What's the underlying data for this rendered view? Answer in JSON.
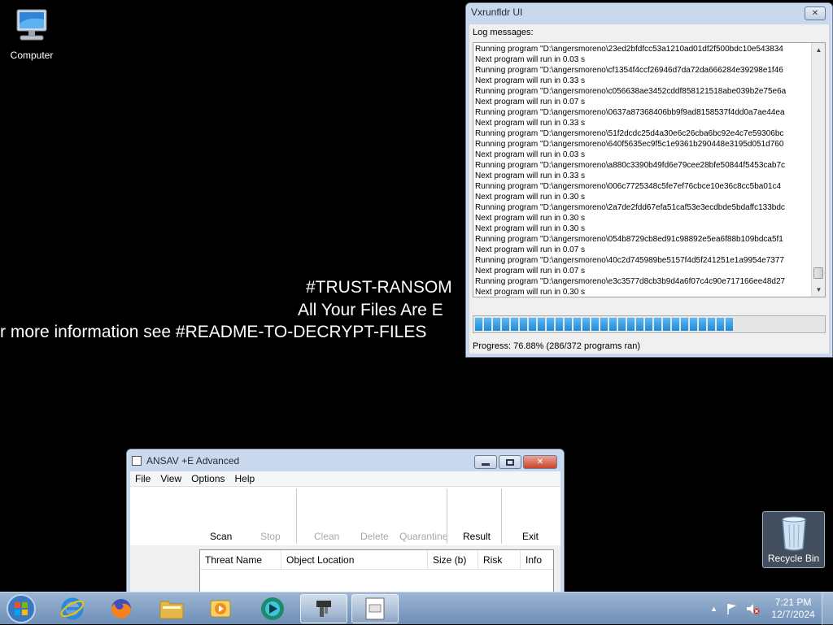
{
  "desktop": {
    "computer_label": "Computer",
    "recycle_label": "Recycle Bin"
  },
  "ransom": {
    "line1": "#TRUST-RANSOM",
    "line2": "All Your Files Are E",
    "line3": "r more information see #README-TO-DECRYPT-FILES"
  },
  "vxrunfldr": {
    "title": "Vxrunfldr UI",
    "close_symbol": "✕",
    "log_label": "Log messages:",
    "log_lines": [
      "Running program \"D:\\angersmoreno\\23ed2bfdfcc53a1210ad01df2f500bdc10e543834",
      "Next program will run in 0.03 s",
      "Running program \"D:\\angersmoreno\\cf1354f4ccf26946d7da72da666284e39298e1f46",
      "Next program will run in 0.33 s",
      "Running program \"D:\\angersmoreno\\c056638ae3452cddf858121518abe039b2e75e6a",
      "Next program will run in 0.07 s",
      "Running program \"D:\\angersmoreno\\0637a87368406bb9f9ad8158537f4dd0a7ae44ea",
      "Next program will run in 0.33 s",
      "Running program \"D:\\angersmoreno\\51f2dcdc25d4a30e6c26cba6bc92e4c7e59306bc",
      "Running program \"D:\\angersmoreno\\640f5635ec9f5c1e9361b290448e3195d051d760",
      "Next program will run in 0.03 s",
      "Running program \"D:\\angersmoreno\\a880c3390b49fd6e79cee28bfe50844f5453cab7c",
      "Next program will run in 0.33 s",
      "Running program \"D:\\angersmoreno\\006c7725348c5fe7ef76cbce10e36c8cc5ba01c4",
      "Next program will run in 0.30 s",
      "Running program \"D:\\angersmoreno\\2a7de2fdd67efa51caf53e3ecdbde5bdaffc133bdc",
      "Next program will run in 0.30 s",
      "Next program will run in 0.30 s",
      "Running program \"D:\\angersmoreno\\054b8729cb8ed91c98892e5ea6f88b109bdca5f1",
      "Next program will run in 0.07 s",
      "Running program \"D:\\angersmoreno\\40c2d745989be5157f4d5f241251e1a9954e7377",
      "Next program will run in 0.07 s",
      "Running program \"D:\\angersmoreno\\e3c3577d8cb3b9d4a6f07c4c90e717166ee48d27",
      "Next program will run in 0.30 s"
    ],
    "progress_fraction": 0.7688,
    "progress_text": "Progress: 76.88% (286/372 programs ran)"
  },
  "ansav": {
    "title": "ANSAV +E Advanced",
    "menu": [
      "File",
      "View",
      "Options",
      "Help"
    ],
    "toolbar": {
      "scan": "Scan",
      "stop": "Stop",
      "clean": "Clean",
      "delete": "Delete",
      "quarantine": "Quarantine",
      "result": "Result",
      "exit": "Exit"
    },
    "columns": [
      "Threat Name",
      "Object Location",
      "Size (b)",
      "Risk",
      "Info"
    ]
  },
  "taskbar": {
    "time": "7:21 PM",
    "date": "12/7/2024"
  },
  "colors": {
    "desktop_bg": "#000000",
    "progress": "#1e8ad8",
    "taskbar": "#7f9cc0"
  }
}
